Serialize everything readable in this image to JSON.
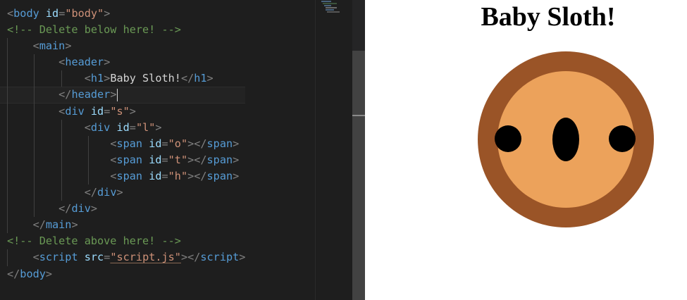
{
  "editor": {
    "lines": [
      [
        {
          "c": "br",
          "t": "<"
        },
        {
          "c": "tag",
          "t": "body"
        },
        {
          "c": "txt",
          "t": " "
        },
        {
          "c": "attr",
          "t": "id"
        },
        {
          "c": "br",
          "t": "="
        },
        {
          "c": "str",
          "t": "\"body\""
        },
        {
          "c": "br",
          "t": ">"
        }
      ],
      [
        {
          "c": "cmt",
          "t": "<!-- Delete below here! -->"
        }
      ],
      [
        {
          "c": "txt",
          "t": "    "
        },
        {
          "c": "br",
          "t": "<"
        },
        {
          "c": "tag",
          "t": "main"
        },
        {
          "c": "br",
          "t": ">"
        }
      ],
      [
        {
          "c": "txt",
          "t": "        "
        },
        {
          "c": "br",
          "t": "<"
        },
        {
          "c": "tag",
          "t": "header"
        },
        {
          "c": "br",
          "t": ">"
        }
      ],
      [
        {
          "c": "txt",
          "t": "            "
        },
        {
          "c": "br",
          "t": "<"
        },
        {
          "c": "tag",
          "t": "h1"
        },
        {
          "c": "br",
          "t": ">"
        },
        {
          "c": "txt",
          "t": "Baby Sloth!"
        },
        {
          "c": "br",
          "t": "</"
        },
        {
          "c": "tag",
          "t": "h1"
        },
        {
          "c": "br",
          "t": ">"
        }
      ],
      [
        {
          "c": "txt",
          "t": "        "
        },
        {
          "c": "br",
          "t": "</"
        },
        {
          "c": "tag",
          "t": "header"
        },
        {
          "c": "br",
          "t": ">"
        }
      ],
      [
        {
          "c": "txt",
          "t": "        "
        },
        {
          "c": "br",
          "t": "<"
        },
        {
          "c": "tag",
          "t": "div"
        },
        {
          "c": "txt",
          "t": " "
        },
        {
          "c": "attr",
          "t": "id"
        },
        {
          "c": "br",
          "t": "="
        },
        {
          "c": "str",
          "t": "\"s\""
        },
        {
          "c": "br",
          "t": ">"
        }
      ],
      [
        {
          "c": "txt",
          "t": "            "
        },
        {
          "c": "br",
          "t": "<"
        },
        {
          "c": "tag",
          "t": "div"
        },
        {
          "c": "txt",
          "t": " "
        },
        {
          "c": "attr",
          "t": "id"
        },
        {
          "c": "br",
          "t": "="
        },
        {
          "c": "str",
          "t": "\"l\""
        },
        {
          "c": "br",
          "t": ">"
        }
      ],
      [
        {
          "c": "txt",
          "t": "                "
        },
        {
          "c": "br",
          "t": "<"
        },
        {
          "c": "tag",
          "t": "span"
        },
        {
          "c": "txt",
          "t": " "
        },
        {
          "c": "attr",
          "t": "id"
        },
        {
          "c": "br",
          "t": "="
        },
        {
          "c": "str",
          "t": "\"o\""
        },
        {
          "c": "br",
          "t": "></"
        },
        {
          "c": "tag",
          "t": "span"
        },
        {
          "c": "br",
          "t": ">"
        }
      ],
      [
        {
          "c": "txt",
          "t": "                "
        },
        {
          "c": "br",
          "t": "<"
        },
        {
          "c": "tag",
          "t": "span"
        },
        {
          "c": "txt",
          "t": " "
        },
        {
          "c": "attr",
          "t": "id"
        },
        {
          "c": "br",
          "t": "="
        },
        {
          "c": "str",
          "t": "\"t\""
        },
        {
          "c": "br",
          "t": "></"
        },
        {
          "c": "tag",
          "t": "span"
        },
        {
          "c": "br",
          "t": ">"
        }
      ],
      [
        {
          "c": "txt",
          "t": "                "
        },
        {
          "c": "br",
          "t": "<"
        },
        {
          "c": "tag",
          "t": "span"
        },
        {
          "c": "txt",
          "t": " "
        },
        {
          "c": "attr",
          "t": "id"
        },
        {
          "c": "br",
          "t": "="
        },
        {
          "c": "str",
          "t": "\"h\""
        },
        {
          "c": "br",
          "t": "></"
        },
        {
          "c": "tag",
          "t": "span"
        },
        {
          "c": "br",
          "t": ">"
        }
      ],
      [
        {
          "c": "txt",
          "t": "            "
        },
        {
          "c": "br",
          "t": "</"
        },
        {
          "c": "tag",
          "t": "div"
        },
        {
          "c": "br",
          "t": ">"
        }
      ],
      [
        {
          "c": "txt",
          "t": "        "
        },
        {
          "c": "br",
          "t": "</"
        },
        {
          "c": "tag",
          "t": "div"
        },
        {
          "c": "br",
          "t": ">"
        }
      ],
      [
        {
          "c": "txt",
          "t": "    "
        },
        {
          "c": "br",
          "t": "</"
        },
        {
          "c": "tag",
          "t": "main"
        },
        {
          "c": "br",
          "t": ">"
        }
      ],
      [
        {
          "c": "cmt",
          "t": "<!-- Delete above here! -->"
        }
      ],
      [
        {
          "c": "txt",
          "t": "    "
        },
        {
          "c": "br",
          "t": "<"
        },
        {
          "c": "tag",
          "t": "script"
        },
        {
          "c": "txt",
          "t": " "
        },
        {
          "c": "attr",
          "t": "src"
        },
        {
          "c": "br",
          "t": "="
        },
        {
          "c": "str",
          "t": "\"script.js\"",
          "u": true
        },
        {
          "c": "br",
          "t": "></"
        },
        {
          "c": "tag",
          "t": "script"
        },
        {
          "c": "br",
          "t": ">"
        }
      ],
      [
        {
          "c": "br",
          "t": "</"
        },
        {
          "c": "tag",
          "t": "body"
        },
        {
          "c": "br",
          "t": ">"
        }
      ]
    ],
    "cursor_line": 5,
    "colors": {
      "background": "#1e1e1e",
      "tag": "#569cd6",
      "attribute": "#9cdcfe",
      "string": "#ce9178",
      "comment": "#6a9955",
      "punctuation": "#808080",
      "text": "#d4d4d4"
    }
  },
  "preview": {
    "title": "Baby Sloth!",
    "colors": {
      "face_outer": "#9a5427",
      "face_inner": "#eca25b",
      "features": "#000000"
    }
  }
}
